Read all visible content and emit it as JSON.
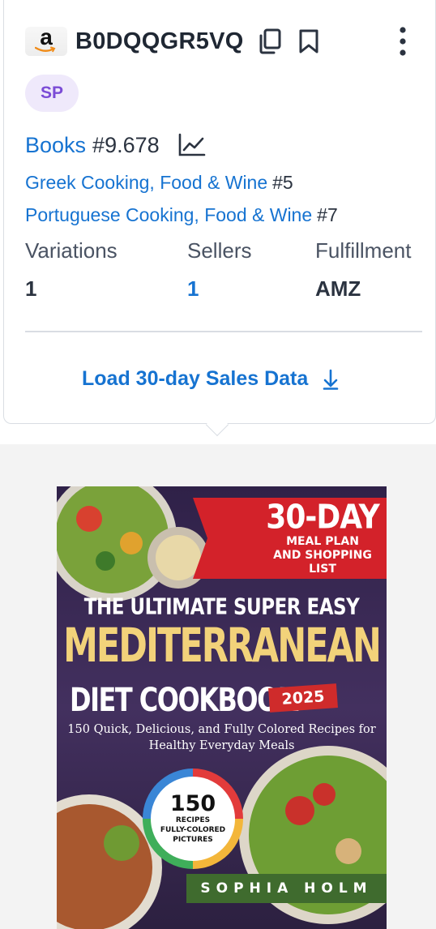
{
  "header": {
    "logo_letter": "a",
    "asin": "B0DQQGR5VQ",
    "icons": [
      "amazon-logo-icon",
      "copy-icon",
      "bookmark-icon",
      "more-vertical-icon"
    ]
  },
  "badge": {
    "label": "SP",
    "color": "#7b4cd6"
  },
  "ranks": {
    "main": {
      "category": "Books",
      "rank": "#9.678"
    },
    "sub": [
      {
        "category": "Greek Cooking, Food & Wine",
        "rank": "#5"
      },
      {
        "category": "Portuguese Cooking, Food & Wine",
        "rank": "#7"
      }
    ]
  },
  "stats": [
    {
      "label": "Variations",
      "value": "1"
    },
    {
      "label": "Sellers",
      "value": "1"
    },
    {
      "label": "Fulfillment",
      "value": "AMZ"
    }
  ],
  "actions": {
    "load_sales": "Load 30-day Sales Data"
  },
  "colors": {
    "link": "#1673d1",
    "text": "#2b3340",
    "panel_bg": "#f3f3f3"
  },
  "cover": {
    "banner_main": "30-DAY",
    "banner_sub_1": "MEAL PLAN",
    "banner_sub_2": "AND SHOPPING LIST",
    "title_top": "THE ULTIMATE SUPER EASY",
    "title_big": "MEDITERRANEAN",
    "title_diet": "DIET COOKBOOK",
    "year": "2025",
    "desc_1": "150 Quick, Delicious, and Fully Colored Recipes for",
    "desc_2": "Healthy Everyday Meals",
    "badge_number": "150",
    "badge_line_1": "RECIPES",
    "badge_line_2": "FULLY-COLORED",
    "badge_line_3": "PICTURES",
    "author": "SOPHIA HOLM"
  }
}
